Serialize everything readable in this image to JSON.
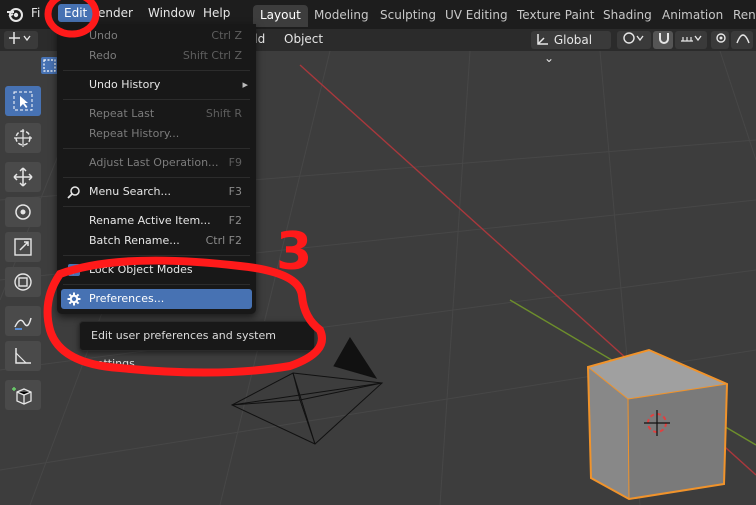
{
  "menubar": {
    "items": [
      "Fi",
      "Edit",
      "ender",
      "Window",
      "Help"
    ]
  },
  "workspaces": [
    "Layout",
    "Modeling",
    "Sculpting",
    "UV Editing",
    "Texture Paint",
    "Shading",
    "Animation",
    "Rend"
  ],
  "header": {
    "add_label": "dd",
    "object_label": "Object",
    "orientation": "Global"
  },
  "edit_menu": {
    "items": [
      {
        "label": "Undo",
        "shortcut": "Ctrl Z"
      },
      {
        "label": "Redo",
        "shortcut": "Shift Ctrl Z"
      },
      {
        "label": "Undo History",
        "shortcut": "▸"
      },
      {
        "label": "Repeat Last",
        "shortcut": "Shift R"
      },
      {
        "label": "Repeat History...",
        "shortcut": ""
      },
      {
        "label": "Adjust Last Operation...",
        "shortcut": "F9"
      },
      {
        "label": "Menu Search...",
        "shortcut": "F3"
      },
      {
        "label": "Rename Active Item...",
        "shortcut": "F2"
      },
      {
        "label": "Batch Rename...",
        "shortcut": "Ctrl F2"
      },
      {
        "label": "Lock Object Modes",
        "shortcut": ""
      },
      {
        "label": "Preferences...",
        "shortcut": ""
      }
    ]
  },
  "tooltip": "Edit user preferences and system settings.",
  "annotation": {
    "step_number": "3",
    "color": "#ff1a1a"
  },
  "colors": {
    "accent": "#4772b3",
    "selection_outline": "#f0932b"
  }
}
